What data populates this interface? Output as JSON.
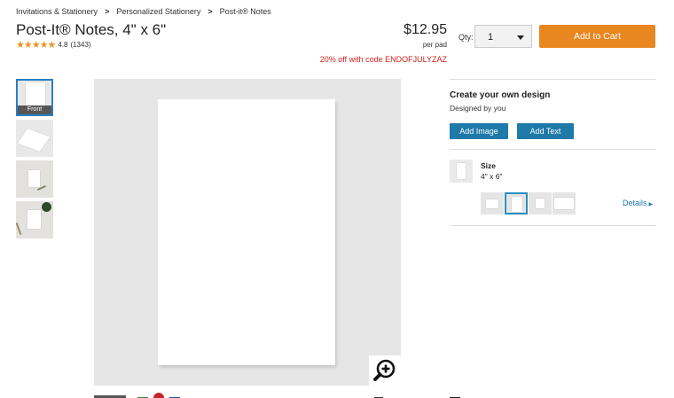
{
  "breadcrumb": [
    "Invitations & Stationery",
    "Personalized Stationery",
    "Post-it® Notes"
  ],
  "product": {
    "title": "Post-It® Notes, 4\" x 6\"",
    "rating": "4.8",
    "stars": "★★★★★",
    "rating_value": 4.8,
    "review_count": "(1343)"
  },
  "pricing": {
    "price": "$12.95",
    "unit": "per pad",
    "promo": "20% off with code ENDOFJULYZAZ"
  },
  "purchase": {
    "qty_label": "Qty:",
    "qty_value": "1",
    "add_to_cart": "Add to Cart"
  },
  "gallery": {
    "front_label": "Front",
    "thumbnails": [
      "front",
      "angle",
      "desk-pen",
      "desk-plant"
    ]
  },
  "design": {
    "title": "Create your own design",
    "subtitle": "Designed by you",
    "add_image": "Add Image",
    "add_text": "Add Text"
  },
  "size": {
    "title": "Size",
    "value": "4\" x 6\"",
    "details_link": "Details",
    "options": [
      "size-option-1",
      "size-option-2",
      "size-option-3",
      "size-option-4"
    ]
  },
  "colors": {
    "accent_orange": "#e8861f",
    "button_blue": "#1e7aa8",
    "promo_red": "#d21f1f",
    "star_orange": "#e8952a"
  }
}
